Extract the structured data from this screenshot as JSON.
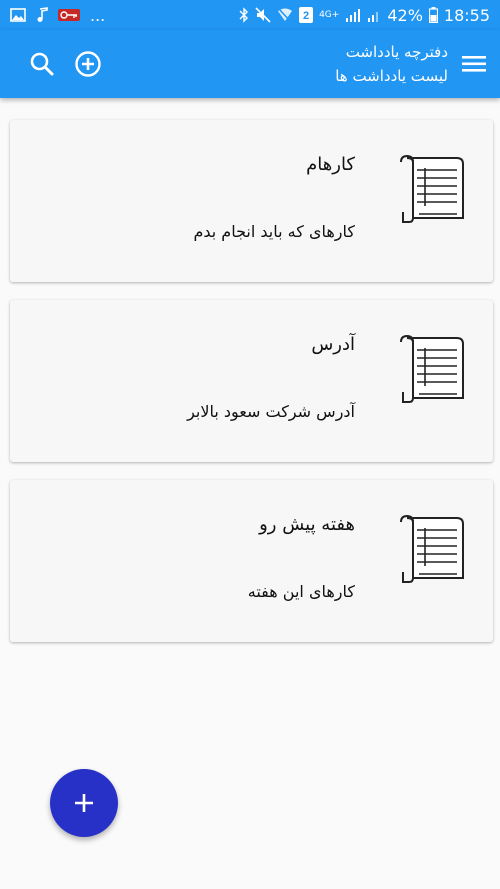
{
  "status_bar": {
    "left_overflow": "...",
    "sim_badge": "2",
    "network": "4G+",
    "battery_percent": "42%",
    "time": "18:55"
  },
  "app_bar": {
    "title": "دفترچه یادداشت",
    "subtitle": "لیست یادداشت ها",
    "icons": [
      "search-icon",
      "add-circle-icon",
      "menu-icon"
    ]
  },
  "notes": [
    {
      "title": "کارهام",
      "description": "کارهای که باید انجام بدم",
      "icon": "notepad-icon"
    },
    {
      "title": "آدرس",
      "description": "آدرس شرکت سعود بالابر",
      "icon": "notepad-icon"
    },
    {
      "title": "هفته پیش رو",
      "description": "کارهای این هفته",
      "icon": "notepad-icon"
    }
  ],
  "fab": {
    "icon": "plus-icon"
  },
  "colors": {
    "primary": "#2196f3",
    "fab": "#2731c8",
    "card": "#f7f7f7",
    "background": "#fafafa"
  }
}
